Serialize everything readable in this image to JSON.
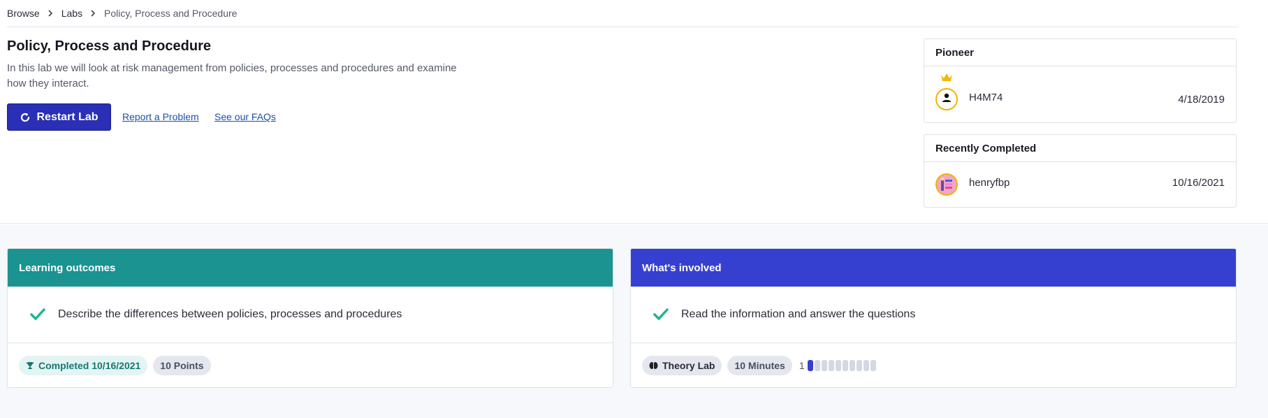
{
  "breadcrumb": {
    "items": [
      "Browse",
      "Labs",
      "Policy, Process and Procedure"
    ]
  },
  "lab": {
    "title": "Policy, Process and Procedure",
    "description": "In this lab we will look at risk management from policies, processes and procedures and examine how they interact.",
    "restart_label": "Restart Lab",
    "report_label": "Report a Problem",
    "faq_label": "See our FAQs"
  },
  "pioneer": {
    "header": "Pioneer",
    "username": "H4M74",
    "date": "4/18/2019",
    "icon": "crown-icon"
  },
  "recent": {
    "header": "Recently Completed",
    "username": "henryfbp",
    "date": "10/16/2021"
  },
  "outcomes": {
    "header": "Learning outcomes",
    "item": "Describe the differences between policies, processes and procedures",
    "completed_label": "Completed 10/16/2021",
    "points_label": "10 Points",
    "header_color": "#1a9391"
  },
  "involved": {
    "header": "What's involved",
    "item": "Read the information and answer the questions",
    "type_label": "Theory Lab",
    "duration_label": "10 Minutes",
    "difficulty_value": "1",
    "difficulty_max": 10,
    "header_color": "#3640d0"
  },
  "colors": {
    "accent_blue": "#2a2fb6",
    "check_green": "#1fb48e",
    "link": "#1f4fa8"
  }
}
